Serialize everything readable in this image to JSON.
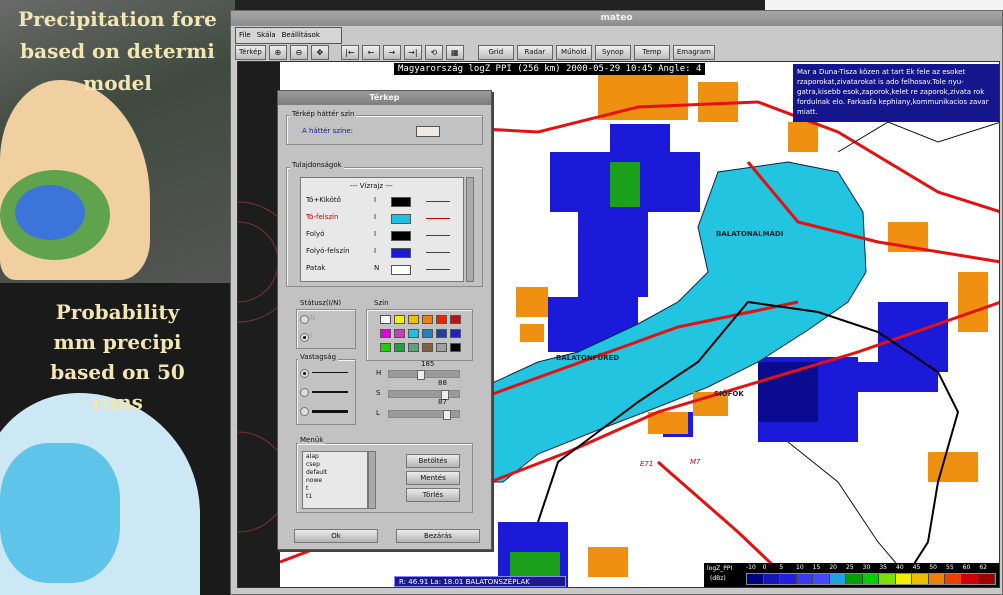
{
  "slides": {
    "top_text": [
      "Precipitation fore",
      "based on determi",
      "model"
    ],
    "bottom_text": [
      "Probability",
      "mm precipi",
      "based on 50",
      "runs"
    ]
  },
  "window": {
    "title": "mateo",
    "menu": [
      "File",
      "Skála",
      "Beállítások"
    ],
    "toolbar": {
      "terkep": "Térkép",
      "icons": [
        "zoom-in-icon",
        "zoom-out-icon",
        "pan-icon",
        "first-icon",
        "prev-icon",
        "next-icon",
        "last-icon",
        "loop-icon",
        "grid-icon"
      ],
      "buttons": [
        "Grid",
        "Radar",
        "Műhold",
        "Synop",
        "Temp",
        "Emagram"
      ]
    }
  },
  "map": {
    "header": "Magyarország logZ  PPI (256 km) 2000-05-29 10:45  Angle: 4",
    "info": "Mar a Duna-Tisza közen at tart Ek fele az esoket rzaporokat,zivatarokat is ado felhosav.Tole nyu- gatra,kisebb esok,zaporok,kelet re zaporok,zivata rok fordulnak elo. Farkasfa kephiany,kommunikacios zavar miatt.",
    "cities": [
      "BALATONALMÁDI",
      "BALATONFÜRED",
      "SIÓFOK"
    ],
    "roads": [
      "E71",
      "M7"
    ],
    "coords": {
      "label": "R:",
      "lat": "46.91",
      "lon_label": "La:",
      "lon": "18.01",
      "place": "BALATONSZÉPLAK"
    },
    "legend": {
      "title": "logZ_PPI",
      "unit": "(dBz)",
      "ticks": [
        "-10",
        "0",
        "5",
        "10",
        "15",
        "20",
        "25",
        "30",
        "35",
        "40",
        "45",
        "50",
        "55",
        "60",
        "62"
      ],
      "colors": [
        "#000080",
        "#1515b8",
        "#2020e0",
        "#3a3af0",
        "#4848ff",
        "#20a0e0",
        "#00a000",
        "#00d000",
        "#7ae000",
        "#f0f000",
        "#f0c000",
        "#f08000",
        "#f04000",
        "#d00000",
        "#a00000"
      ]
    }
  },
  "dialog": {
    "title": "Térkep",
    "bg_group": "Térkép háttér szín",
    "bg_label": "A háttér színe:",
    "props_group": "Tulajdonságok",
    "list_header": "--- Vízrajz ---",
    "rows": [
      {
        "name": "Tó+Kikötő",
        "flag": "I",
        "color": "#000000",
        "line": "#444444"
      },
      {
        "name": "Tó-felszín",
        "flag": "I",
        "color": "#20c0e0",
        "line": "#d00000",
        "red": true
      },
      {
        "name": "Folyó",
        "flag": "I",
        "color": "#000000",
        "line": "#444444"
      },
      {
        "name": "Folyó-felszín",
        "flag": "I",
        "color": "#1a1ad8",
        "line": "#444444"
      },
      {
        "name": "Patak",
        "flag": "N",
        "color": "#ffffff",
        "line": "#444444"
      }
    ],
    "status_group": "Státusz(I/N)",
    "status_options": [
      "N",
      "I"
    ],
    "color_group": "Szín",
    "palette": [
      "#ffffff",
      "#f0f000",
      "#f0c000",
      "#f08000",
      "#f02000",
      "#c01010",
      "#e000e0",
      "#c040c0",
      "#20c0e0",
      "#2080c0",
      "#2040a0",
      "#2020c0",
      "#20d000",
      "#20a040",
      "#60a080",
      "#806040",
      "#a0a0a0",
      "#000000"
    ],
    "thickness_group": "Vastagság",
    "sliders": [
      {
        "label": "H",
        "value": "185"
      },
      {
        "label": "S",
        "value": "88"
      },
      {
        "label": "L",
        "value": "87"
      }
    ],
    "menu_group": "Menük",
    "menu_items": [
      "alap",
      "csep",
      "default",
      "nowe",
      "t",
      "t1"
    ],
    "load": "Betöltés",
    "save": "Mentés",
    "delete": "Törlés",
    "ok": "Ok",
    "close": "Bezárás"
  }
}
